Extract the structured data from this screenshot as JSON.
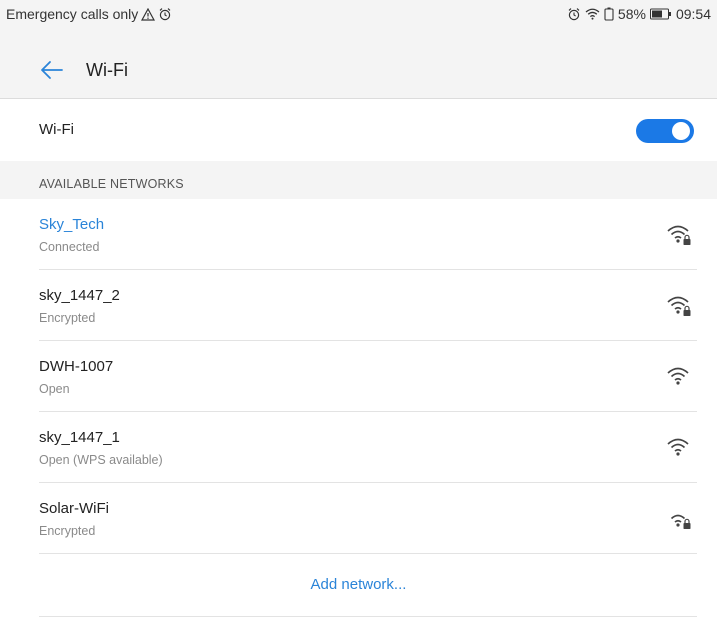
{
  "status_bar": {
    "left_text": "Emergency calls only",
    "battery_percent": "58%",
    "time": "09:54"
  },
  "app_bar": {
    "title": "Wi-Fi"
  },
  "wifi_toggle": {
    "label": "Wi-Fi",
    "enabled": true
  },
  "available_networks": {
    "header": "AVAILABLE NETWORKS",
    "items": [
      {
        "name": "Sky_Tech",
        "status": "Connected",
        "locked": true,
        "connected": true
      },
      {
        "name": "sky_1447_2",
        "status": "Encrypted",
        "locked": true,
        "connected": false
      },
      {
        "name": "DWH-1007",
        "status": "Open",
        "locked": false,
        "connected": false
      },
      {
        "name": "sky_1447_1",
        "status": "Open (WPS available)",
        "locked": false,
        "connected": false
      },
      {
        "name": "Solar-WiFi",
        "status": "Encrypted",
        "locked": true,
        "connected": false
      }
    ]
  },
  "add_network": {
    "label": "Add network..."
  },
  "colors": {
    "accent": "#1b79e6",
    "link": "#2a84d8",
    "header_bg": "#f4f4f4"
  }
}
